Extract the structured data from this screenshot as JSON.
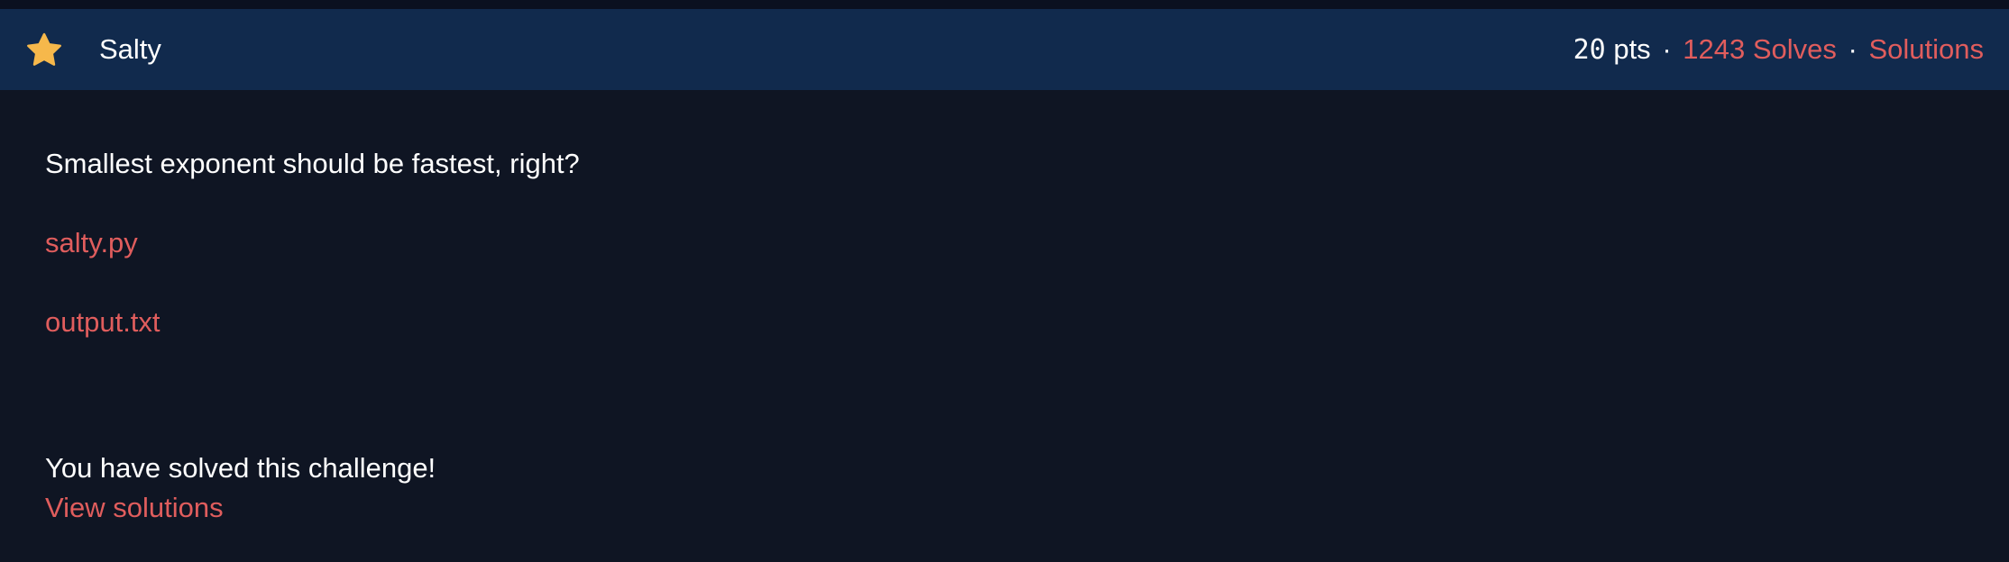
{
  "header": {
    "star_icon": "star-icon",
    "title": "Salty",
    "points_number": "20",
    "points_unit": " pts",
    "separator": "·",
    "solves_link": "1243 Solves",
    "solutions_link": "Solutions"
  },
  "challenge": {
    "description": "Smallest exponent should be fastest, right?",
    "files": [
      "salty.py",
      "output.txt"
    ],
    "solved_message": "You have solved this challenge!",
    "view_solutions_link": "View solutions"
  },
  "colors": {
    "background": "#0f1523",
    "header_background": "#112a4d",
    "accent_link": "#e05d5d",
    "star": "#f6b84b",
    "text": "#ffffff"
  }
}
